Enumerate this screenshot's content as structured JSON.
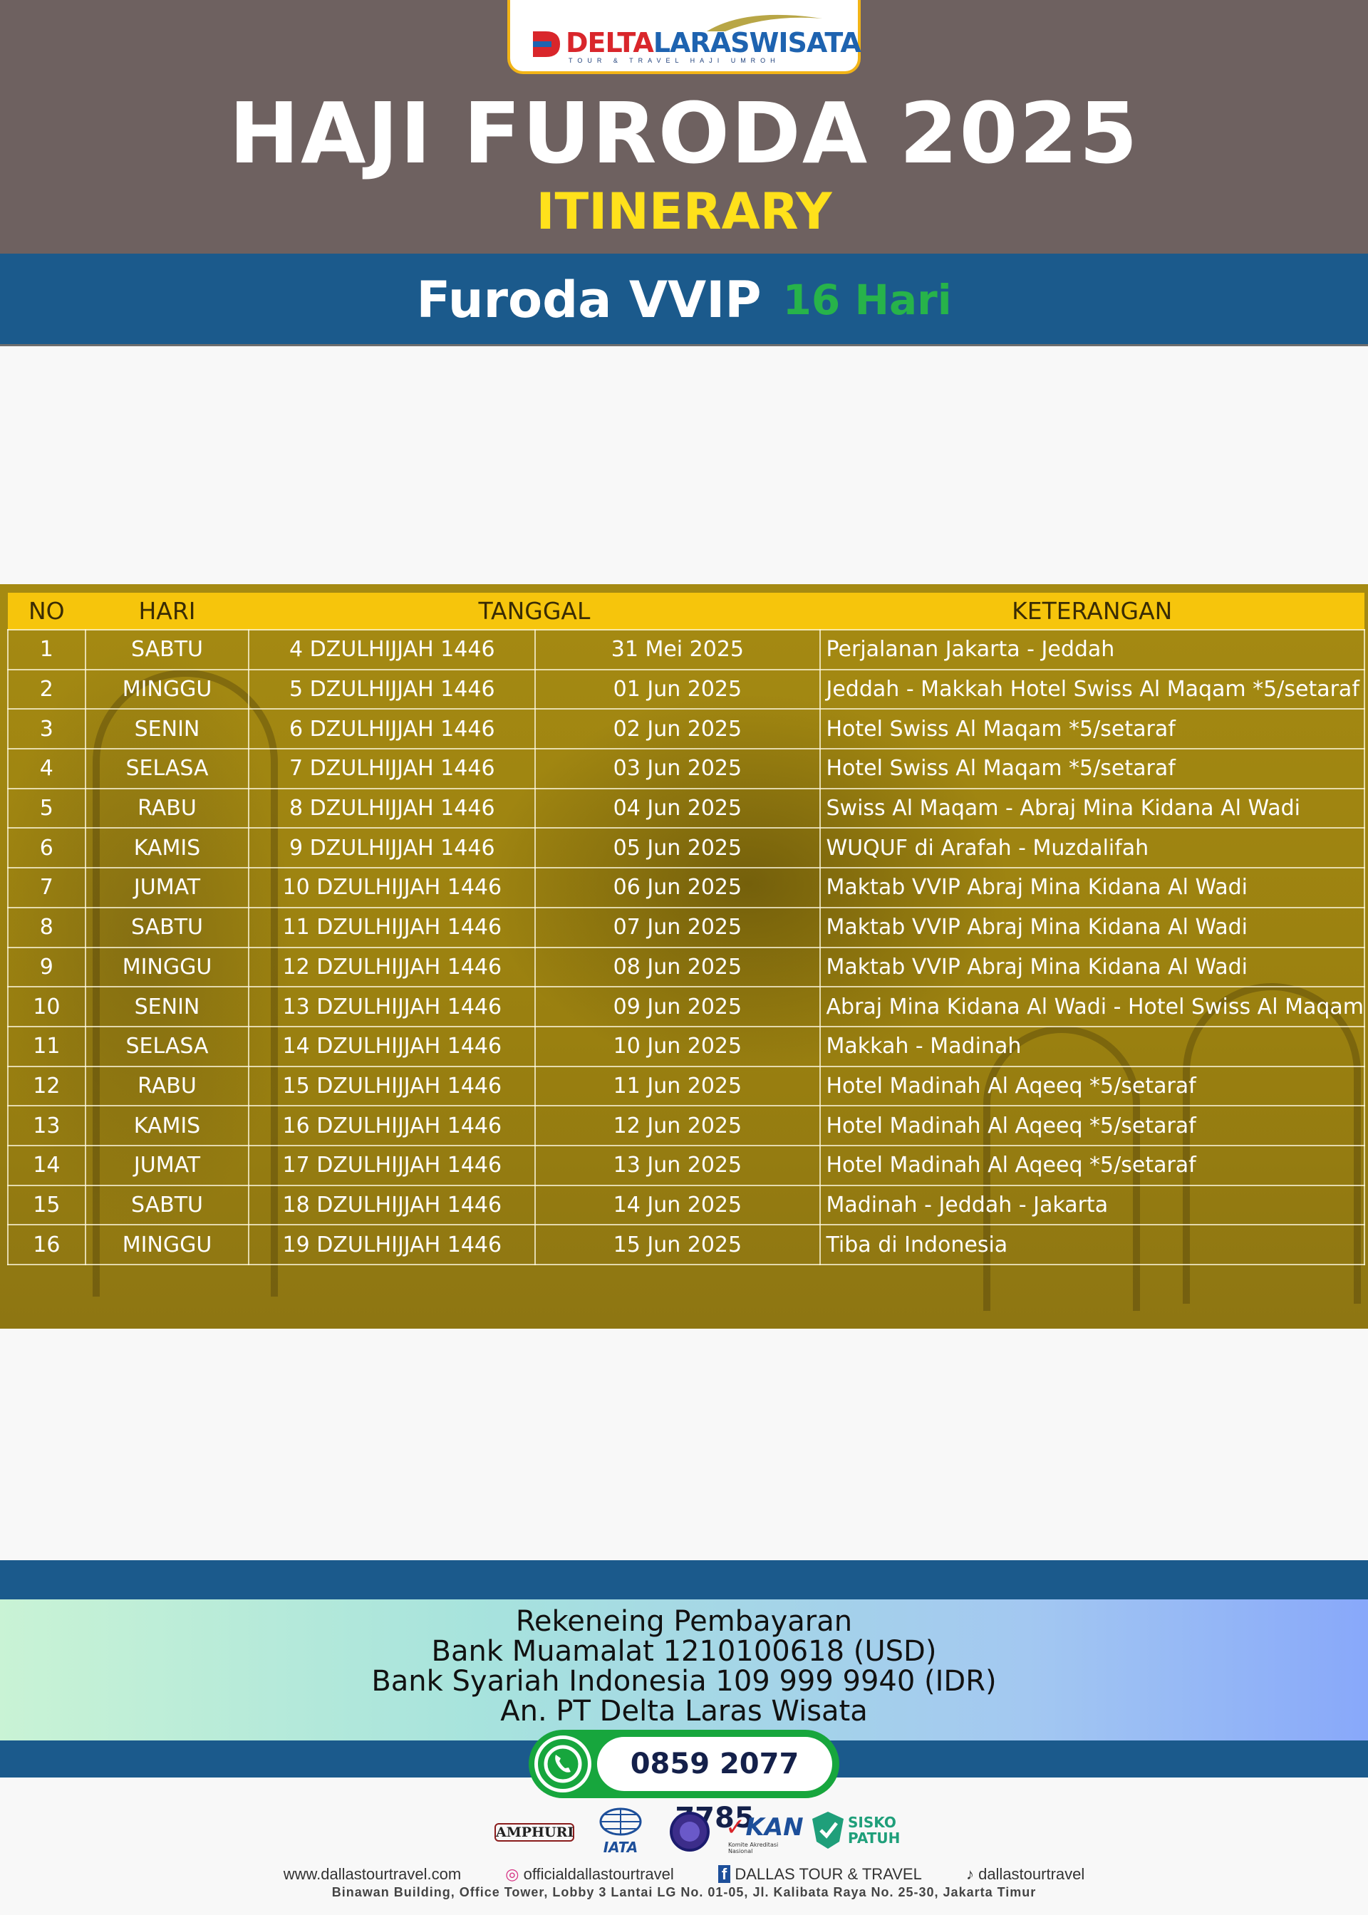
{
  "logo": {
    "brand_a": "DELTA",
    "brand_b": "LARASWISATA",
    "tagline": "TOUR & TRAVEL HAJI UMROH"
  },
  "header": {
    "title": "HAJI FURODA 2025",
    "subtitle": "ITINERARY"
  },
  "banner": {
    "package": "Furoda VVIP",
    "duration": "16 Hari"
  },
  "table": {
    "headers": {
      "no": "NO",
      "hari": "HARI",
      "tanggal": "TANGGAL",
      "keterangan": "KETERANGAN"
    },
    "rows": [
      {
        "no": "1",
        "hari": "SABTU",
        "hijri": "4 DZULHIJJAH 1446",
        "masehi": "31 Mei 2025",
        "ket": "Perjalanan Jakarta - Jeddah"
      },
      {
        "no": "2",
        "hari": "MINGGU",
        "hijri": "5 DZULHIJJAH 1446",
        "masehi": "01 Jun 2025",
        "ket": "Jeddah - Makkah Hotel Swiss Al Maqam *5/setaraf"
      },
      {
        "no": "3",
        "hari": "SENIN",
        "hijri": "6 DZULHIJJAH 1446",
        "masehi": "02 Jun 2025",
        "ket": "Hotel Swiss Al Maqam *5/setaraf"
      },
      {
        "no": "4",
        "hari": "SELASA",
        "hijri": "7 DZULHIJJAH 1446",
        "masehi": "03 Jun 2025",
        "ket": "Hotel Swiss Al Maqam *5/setaraf"
      },
      {
        "no": "5",
        "hari": "RABU",
        "hijri": "8 DZULHIJJAH 1446",
        "masehi": "04 Jun 2025",
        "ket": "Swiss Al Maqam - Abraj Mina Kidana Al Wadi"
      },
      {
        "no": "6",
        "hari": "KAMIS",
        "hijri": "9 DZULHIJJAH 1446",
        "masehi": "05 Jun 2025",
        "ket": "WUQUF di Arafah - Muzdalifah"
      },
      {
        "no": "7",
        "hari": "JUMAT",
        "hijri": "10 DZULHIJJAH 1446",
        "masehi": "06 Jun 2025",
        "ket": "Maktab VVIP Abraj Mina Kidana Al Wadi"
      },
      {
        "no": "8",
        "hari": "SABTU",
        "hijri": "11 DZULHIJJAH 1446",
        "masehi": "07 Jun 2025",
        "ket": "Maktab VVIP Abraj Mina Kidana Al Wadi"
      },
      {
        "no": "9",
        "hari": "MINGGU",
        "hijri": "12 DZULHIJJAH 1446",
        "masehi": "08 Jun 2025",
        "ket": "Maktab VVIP Abraj Mina Kidana Al Wadi"
      },
      {
        "no": "10",
        "hari": "SENIN",
        "hijri": "13 DZULHIJJAH 1446",
        "masehi": "09 Jun 2025",
        "ket": "Abraj Mina Kidana Al Wadi - Hotel Swiss Al Maqam"
      },
      {
        "no": "11",
        "hari": "SELASA",
        "hijri": "14 DZULHIJJAH 1446",
        "masehi": "10 Jun 2025",
        "ket": "Makkah - Madinah"
      },
      {
        "no": "12",
        "hari": "RABU",
        "hijri": "15 DZULHIJJAH 1446",
        "masehi": "11 Jun 2025",
        "ket": "Hotel Madinah Al Aqeeq *5/setaraf"
      },
      {
        "no": "13",
        "hari": "KAMIS",
        "hijri": "16 DZULHIJJAH 1446",
        "masehi": "12 Jun 2025",
        "ket": "Hotel Madinah Al Aqeeq *5/setaraf"
      },
      {
        "no": "14",
        "hari": "JUMAT",
        "hijri": "17 DZULHIJJAH 1446",
        "masehi": "13 Jun 2025",
        "ket": "Hotel Madinah Al Aqeeq *5/setaraf"
      },
      {
        "no": "15",
        "hari": "SABTU",
        "hijri": "18 DZULHIJJAH 1446",
        "masehi": "14 Jun 2025",
        "ket": "Madinah - Jeddah - Jakarta"
      },
      {
        "no": "16",
        "hari": "MINGGU",
        "hijri": "19 DZULHIJJAH 1446",
        "masehi": "15 Jun 2025",
        "ket": "Tiba di Indonesia"
      }
    ]
  },
  "payment": {
    "heading": "Rekeneing Pembayaran",
    "bank1": "Bank Muamalat 1210100618 (USD)",
    "bank2": "Bank Syariah Indonesia 109 999 9940 (IDR)",
    "account_name": "An. PT Delta Laras Wisata"
  },
  "contact": {
    "phone": "0859 2077 7785"
  },
  "affiliations": {
    "amphuri": "AMPHURI",
    "iata": "IATA",
    "kan": "KAN",
    "kan_caption": "Komite Akreditasi Nasional",
    "sisko_a": "SISKO",
    "sisko_b": "PATUH"
  },
  "footer": {
    "website": "www.dallastourtravel.com",
    "instagram": "officialdallastourtravel",
    "facebook": "DALLAS TOUR & TRAVEL",
    "tiktok": "dallastourtravel",
    "address": "Binawan Building, Office Tower, Lobby 3 Lantai LG No. 01-05, Jl. Kalibata Raya No. 25-30, Jakarta Timur"
  },
  "colors": {
    "header_bg": "#6e6160",
    "banner_bg": "#1b5a8c",
    "title": "#ffffff",
    "subtitle": "#ffe11b",
    "duration": "#27b34a",
    "table_header": "#f6c50c",
    "table_bg": "#9a8010",
    "whatsapp": "#17a63d"
  },
  "icons": [
    "whatsapp-icon",
    "instagram-icon",
    "facebook-icon",
    "tiktok-icon"
  ]
}
